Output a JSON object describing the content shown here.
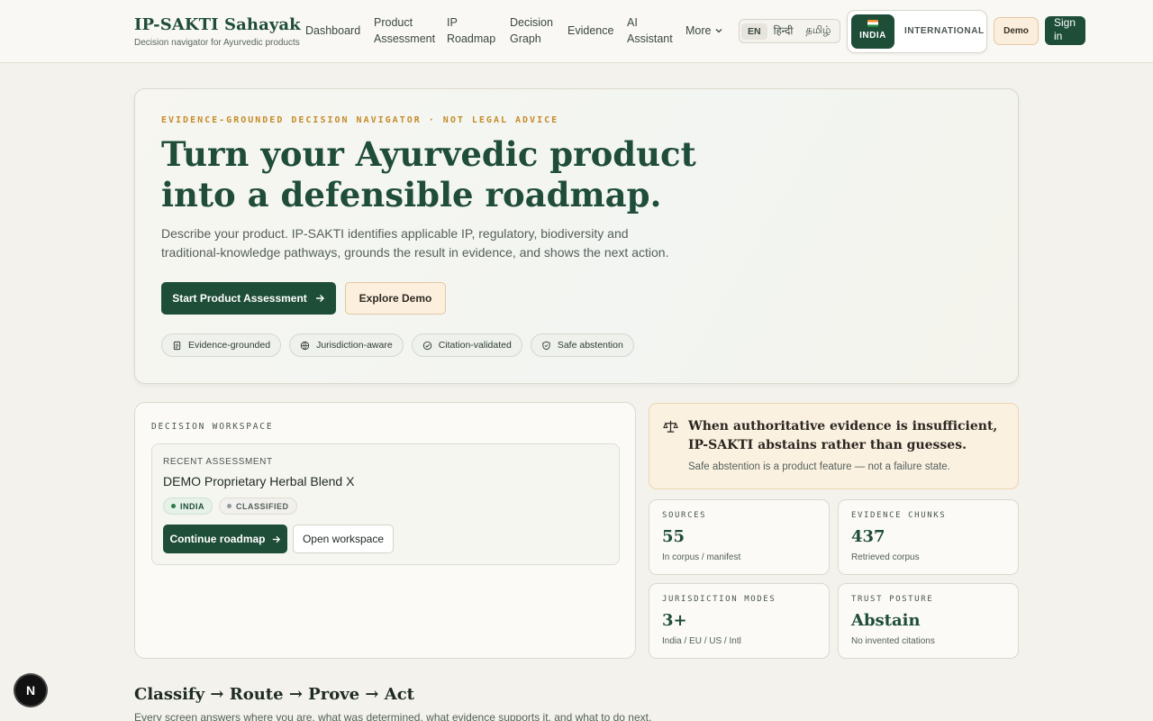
{
  "brand": {
    "title": "IP-SAKTI Sahayak",
    "subtitle": "Decision navigator for Ayurvedic products"
  },
  "nav": {
    "links": [
      "Dashboard",
      "Product Assessment",
      "IP Roadmap",
      "Decision Graph",
      "Evidence",
      "AI Assistant"
    ],
    "more_label": "More",
    "languages": [
      "EN",
      "हिन्दी",
      "தமிழ்"
    ],
    "jurisdictions": {
      "india": "INDIA",
      "international": "INTERNATIONAL"
    },
    "demo_label": "Demo",
    "signin_label": "Sign in"
  },
  "hero": {
    "eyebrow": "EVIDENCE-GROUNDED DECISION NAVIGATOR · NOT LEGAL ADVICE",
    "title": "Turn your Ayurvedic product into a defensible roadmap.",
    "description": "Describe your product. IP-SAKTI identifies applicable IP, regulatory, biodiversity and traditional-knowledge pathways, grounds the result in evidence, and shows the next action.",
    "primary_cta": "Start Product Assessment",
    "secondary_cta": "Explore Demo",
    "chips": [
      {
        "label": "Evidence-grounded",
        "icon": "document-icon"
      },
      {
        "label": "Jurisdiction-aware",
        "icon": "globe-icon"
      },
      {
        "label": "Citation-validated",
        "icon": "check-circle-icon"
      },
      {
        "label": "Safe abstention",
        "icon": "shield-icon"
      }
    ]
  },
  "workspace": {
    "label": "DECISION WORKSPACE",
    "recent_label": "RECENT ASSESSMENT",
    "recent_title": "DEMO Proprietary Herbal Blend X",
    "tags": [
      "INDIA",
      "CLASSIFIED"
    ],
    "continue_label": "Continue roadmap",
    "open_label": "Open workspace"
  },
  "abstain": {
    "title": "When authoritative evidence is insufficient, IP-SAKTI abstains rather than guesses.",
    "subtitle": "Safe abstention is a product feature — not a failure state.",
    "icon": "scales-icon"
  },
  "stats": [
    {
      "label": "SOURCES",
      "value": "55",
      "sub": "In corpus / manifest"
    },
    {
      "label": "EVIDENCE CHUNKS",
      "value": "437",
      "sub": "Retrieved corpus"
    },
    {
      "label": "JURISDICTION MODES",
      "value": "3+",
      "sub": "India / EU / US / Intl"
    },
    {
      "label": "TRUST POSTURE",
      "value": "Abstain",
      "sub": "No invented citations"
    }
  ],
  "bottom": {
    "title": "Classify → Route → Prove → Act",
    "subtitle": "Every screen answers where you are, what was determined, what evidence supports it, and what to do next."
  },
  "badge": "N",
  "colors": {
    "primary": "#1e4d38",
    "accent": "#c58b2a",
    "warm": "#fbf1e1"
  }
}
